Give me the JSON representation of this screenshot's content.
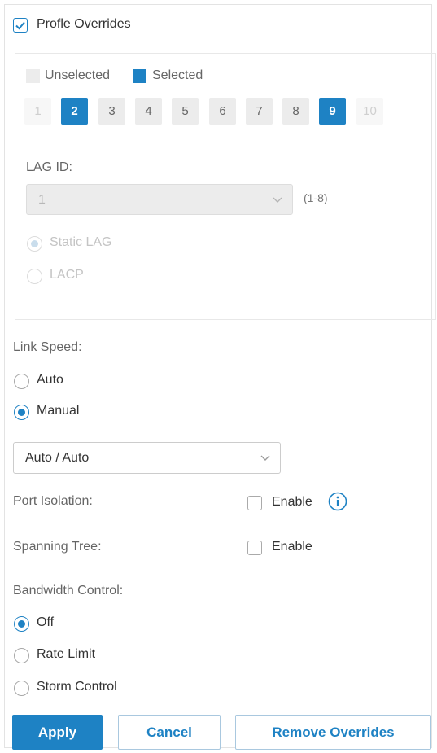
{
  "profile_overrides": {
    "label": "Profle Overrides",
    "checked": true
  },
  "legend": {
    "unselected": "Unselected",
    "selected": "Selected"
  },
  "ports": [
    {
      "label": "1",
      "state": "disabled"
    },
    {
      "label": "2",
      "state": "selected"
    },
    {
      "label": "3",
      "state": "normal"
    },
    {
      "label": "4",
      "state": "normal"
    },
    {
      "label": "5",
      "state": "normal"
    },
    {
      "label": "6",
      "state": "normal"
    },
    {
      "label": "7",
      "state": "normal"
    },
    {
      "label": "8",
      "state": "normal"
    },
    {
      "label": "9",
      "state": "selected"
    },
    {
      "label": "10",
      "state": "disabled"
    }
  ],
  "lag": {
    "label": "LAG ID:",
    "value": "1",
    "range": "(1-8)",
    "options": [
      {
        "label": "Static LAG",
        "checked": true
      },
      {
        "label": "LACP",
        "checked": false
      }
    ]
  },
  "link_speed": {
    "label": "Link Speed:",
    "options": [
      {
        "label": "Auto",
        "checked": false
      },
      {
        "label": "Manual",
        "checked": true
      }
    ],
    "select_value": "Auto / Auto"
  },
  "port_isolation": {
    "label": "Port Isolation:",
    "checkbox_label": "Enable",
    "checked": false
  },
  "spanning_tree": {
    "label": "Spanning Tree:",
    "checkbox_label": "Enable",
    "checked": false
  },
  "bandwidth_control": {
    "label": "Bandwidth Control:",
    "options": [
      {
        "label": "Off",
        "checked": true
      },
      {
        "label": "Rate Limit",
        "checked": false
      },
      {
        "label": "Storm Control",
        "checked": false
      }
    ]
  },
  "buttons": {
    "apply": "Apply",
    "cancel": "Cancel",
    "remove": "Remove Overrides"
  },
  "colors": {
    "accent": "#1e82c4",
    "unselected": "#ececec",
    "disabled_bg": "#ececec"
  },
  "icons": {
    "checkbox_check": "check-icon",
    "dropdown": "chevron-down-icon",
    "info": "info-icon"
  }
}
